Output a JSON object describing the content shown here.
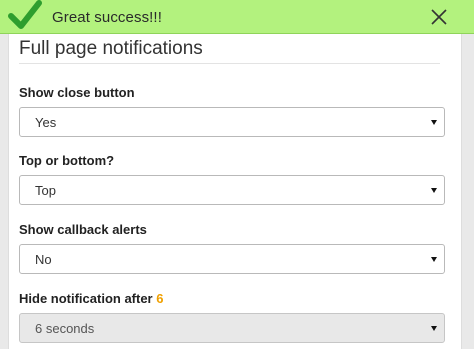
{
  "notification": {
    "message": "Great success!!!",
    "icon": "checkmark-icon",
    "close_icon": "close-icon",
    "background": "#b3f27e",
    "check_color": "#2e9e2e"
  },
  "panel": {
    "title": "Full page notifications"
  },
  "fields": [
    {
      "label": "Show close button",
      "value": "Yes",
      "disabled": false
    },
    {
      "label": "Top or bottom?",
      "value": "Top",
      "disabled": false
    },
    {
      "label": "Show callback alerts",
      "value": "No",
      "disabled": false
    },
    {
      "label": "Hide notification after ",
      "label_accent": "6",
      "accent_color": "#f0a000",
      "value": "6 seconds",
      "disabled": true
    }
  ]
}
